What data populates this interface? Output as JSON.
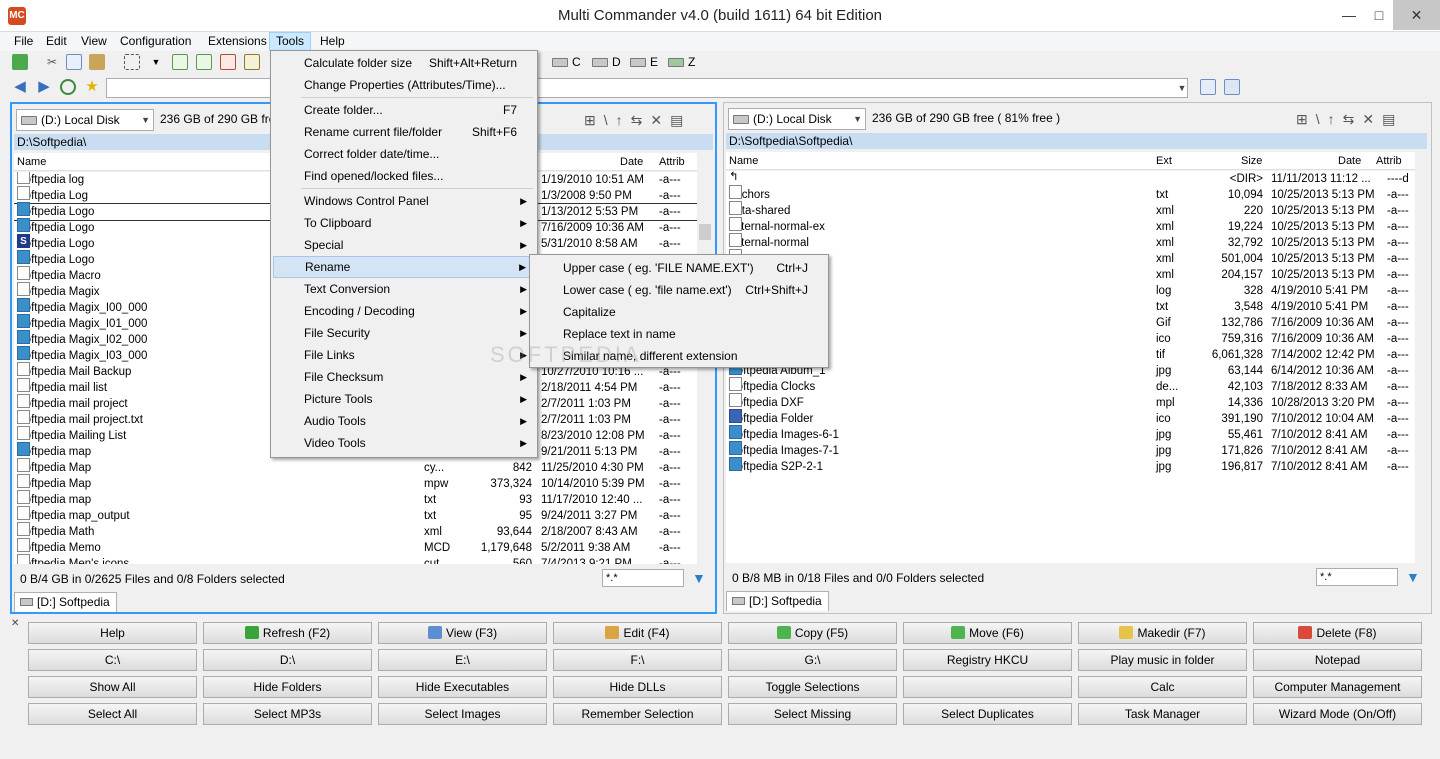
{
  "window": {
    "title": "Multi Commander v4.0 (build 1611) 64 bit Edition",
    "app_icon_text": "MC",
    "min_glyph": "—",
    "max_glyph": "□",
    "close_glyph": "✕"
  },
  "menubar": [
    "File",
    "Edit",
    "View",
    "Configuration",
    "Extensions",
    "Tools",
    "Help"
  ],
  "drives_toolbar": [
    {
      "letter": "C",
      "icon": "hard-drive-icon"
    },
    {
      "letter": "D",
      "icon": "hard-drive-icon"
    },
    {
      "letter": "E",
      "icon": "hard-drive-icon"
    },
    {
      "letter": "Z",
      "icon": "network-drive-icon"
    }
  ],
  "tools_menu": {
    "items": [
      {
        "label": "Calculate folder size",
        "shortcut": "Shift+Alt+Return",
        "submenu": false
      },
      {
        "label": "Change Properties (Attributes/Time)...",
        "shortcut": "",
        "submenu": false
      },
      {
        "label": "Create folder...",
        "shortcut": "F7",
        "submenu": false
      },
      {
        "label": "Rename current file/folder",
        "shortcut": "Shift+F6",
        "submenu": false
      },
      {
        "label": "Correct folder date/time...",
        "shortcut": "",
        "submenu": false
      },
      {
        "label": "Find opened/locked files...",
        "shortcut": "",
        "submenu": false
      },
      {
        "label": "Windows Control Panel",
        "shortcut": "",
        "submenu": true
      },
      {
        "label": "To Clipboard",
        "shortcut": "",
        "submenu": true
      },
      {
        "label": "Special",
        "shortcut": "",
        "submenu": true
      },
      {
        "label": "Rename",
        "shortcut": "",
        "submenu": true,
        "highlighted": true
      },
      {
        "label": "Text Conversion",
        "shortcut": "",
        "submenu": true
      },
      {
        "label": "Encoding / Decoding",
        "shortcut": "",
        "submenu": true
      },
      {
        "label": "File Security",
        "shortcut": "",
        "submenu": true
      },
      {
        "label": "File Links",
        "shortcut": "",
        "submenu": true
      },
      {
        "label": "File Checksum",
        "shortcut": "",
        "submenu": true
      },
      {
        "label": "Picture Tools",
        "shortcut": "",
        "submenu": true
      },
      {
        "label": "Audio Tools",
        "shortcut": "",
        "submenu": true
      },
      {
        "label": "Video Tools",
        "shortcut": "",
        "submenu": true
      }
    ],
    "submenu_arrow": "▶"
  },
  "rename_menu": [
    {
      "label": "Upper case ( eg. 'FILE NAME.EXT')",
      "shortcut": "Ctrl+J"
    },
    {
      "label": "Lower case ( eg. 'file name.ext')",
      "shortcut": "Ctrl+Shift+J"
    },
    {
      "label": "Capitalize",
      "shortcut": ""
    },
    {
      "label": "Replace text in name",
      "shortcut": ""
    },
    {
      "label": "Similar name, different extension",
      "shortcut": ""
    }
  ],
  "left_panel": {
    "drive": "(D:) Local Disk",
    "free": "236 GB of 290 GB free",
    "path": "D:\\Softpedia\\",
    "columns": {
      "name": "Name",
      "date": "Date",
      "attrib": "Attrib"
    },
    "rows": [
      {
        "name": "Softpedia log",
        "ext": "",
        "size": "",
        "date": "1/19/2010 10:51 AM",
        "attr": "-a---",
        "icon": "doc"
      },
      {
        "name": "Softpedia Log",
        "ext": "",
        "size": "",
        "date": "1/3/2008 9:50 PM",
        "attr": "-a---",
        "icon": "doc"
      },
      {
        "name": "Softpedia Logo",
        "ext": "",
        "size": "",
        "date": "1/13/2012 5:53 PM",
        "attr": "-a---",
        "icon": "img"
      },
      {
        "name": "Softpedia Logo",
        "ext": "",
        "size": "",
        "date": "7/16/2009 10:36 AM",
        "attr": "-a---",
        "icon": "img"
      },
      {
        "name": "Softpedia Logo",
        "ext": "",
        "size": "",
        "date": "5/31/2010 8:58 AM",
        "attr": "-a---",
        "icon": "s"
      },
      {
        "name": "Softpedia Logo",
        "ext": "",
        "size": "",
        "date": "",
        "attr": "",
        "icon": "img"
      },
      {
        "name": "Softpedia Macro",
        "ext": "",
        "size": "",
        "date": "",
        "attr": "",
        "icon": "doc"
      },
      {
        "name": "Softpedia Magix",
        "ext": "",
        "size": "",
        "date": "",
        "attr": "",
        "icon": "doc"
      },
      {
        "name": "Softpedia Magix_I00_000",
        "ext": "",
        "size": "",
        "date": "",
        "attr": "",
        "icon": "img"
      },
      {
        "name": "Softpedia Magix_I01_000",
        "ext": "",
        "size": "",
        "date": "",
        "attr": "",
        "icon": "img"
      },
      {
        "name": "Softpedia Magix_I02_000",
        "ext": "",
        "size": "",
        "date": "",
        "attr": "",
        "icon": "img"
      },
      {
        "name": "Softpedia Magix_I03_000",
        "ext": "",
        "size": "",
        "date": "",
        "attr": "",
        "icon": "img"
      },
      {
        "name": "Softpedia Mail Backup",
        "ext": "",
        "size": "",
        "date": "10/27/2010 10:16 ...",
        "attr": "-a---",
        "icon": "doc"
      },
      {
        "name": "Softpedia mail list",
        "ext": "",
        "size": "",
        "date": "2/18/2011 4:54 PM",
        "attr": "-a---",
        "icon": "doc"
      },
      {
        "name": "Softpedia mail project",
        "ext": "",
        "size": "",
        "date": "2/7/2011 1:03 PM",
        "attr": "-a---",
        "icon": "doc"
      },
      {
        "name": "Softpedia mail project.txt",
        "ext": "",
        "size": "",
        "date": "2/7/2011 1:03 PM",
        "attr": "-a---",
        "icon": "doc"
      },
      {
        "name": "Softpedia Mailing List",
        "ext": "",
        "size": "",
        "date": "8/23/2010 12:08 PM",
        "attr": "-a---",
        "icon": "doc"
      },
      {
        "name": "Softpedia map",
        "ext": "",
        "size": "",
        "date": "9/21/2011 5:13 PM",
        "attr": "-a---",
        "icon": "img"
      },
      {
        "name": "Softpedia Map",
        "ext": "cy...",
        "size": "842",
        "date": "11/25/2010 4:30 PM",
        "attr": "-a---",
        "icon": "doc"
      },
      {
        "name": "Softpedia Map",
        "ext": "mpw",
        "size": "373,324",
        "date": "10/14/2010 5:39 PM",
        "attr": "-a---",
        "icon": "doc"
      },
      {
        "name": "Softpedia map",
        "ext": "txt",
        "size": "93",
        "date": "11/17/2010 12:40 ...",
        "attr": "-a---",
        "icon": "doc"
      },
      {
        "name": "Softpedia map_output",
        "ext": "txt",
        "size": "95",
        "date": "9/24/2011 3:27 PM",
        "attr": "-a---",
        "icon": "doc"
      },
      {
        "name": "Softpedia Math",
        "ext": "xml",
        "size": "93,644",
        "date": "2/18/2007 8:43 AM",
        "attr": "-a---",
        "icon": "doc"
      },
      {
        "name": "Softpedia Memo",
        "ext": "MCD",
        "size": "1,179,648",
        "date": "5/2/2011 9:38 AM",
        "attr": "-a---",
        "icon": "doc"
      },
      {
        "name": "Softpedia Men's icons",
        "ext": "cut",
        "size": "560",
        "date": "7/4/2013 9:21 PM",
        "attr": "-a---",
        "icon": "doc"
      }
    ],
    "status": "0 B/4 GB in 0/2625 Files and 0/8 Folders selected",
    "filter": "*.*",
    "tab": "[D:] Softpedia"
  },
  "right_panel": {
    "drive": "(D:) Local Disk",
    "free": "236 GB of 290 GB free ( 81% free )",
    "path": "D:\\Softpedia\\Softpedia\\",
    "columns": {
      "name": "Name",
      "ext": "Ext",
      "size": "Size",
      "date": "Date",
      "attrib": "Attrib"
    },
    "rows": [
      {
        "name": "..",
        "ext": "",
        "size": "<DIR>",
        "date": "11/11/2013 11:12 ...",
        "attr": "----d",
        "icon": "up"
      },
      {
        "name": "anchors",
        "ext": "txt",
        "size": "10,094",
        "date": "10/25/2013 5:13 PM",
        "attr": "-a---",
        "icon": "doc"
      },
      {
        "name": "data-shared",
        "ext": "xml",
        "size": "220",
        "date": "10/25/2013 5:13 PM",
        "attr": "-a---",
        "icon": "doc"
      },
      {
        "name": "external-normal-ex",
        "ext": "xml",
        "size": "19,224",
        "date": "10/25/2013 5:13 PM",
        "attr": "-a---",
        "icon": "doc"
      },
      {
        "name": "external-normal",
        "ext": "xml",
        "size": "32,792",
        "date": "10/25/2013 5:13 PM",
        "attr": "-a---",
        "icon": "doc"
      },
      {
        "name": "",
        "ext": "xml",
        "size": "501,004",
        "date": "10/25/2013 5:13 PM",
        "attr": "-a---",
        "icon": "doc"
      },
      {
        "name": "",
        "ext": "xml",
        "size": "204,157",
        "date": "10/25/2013 5:13 PM",
        "attr": "-a---",
        "icon": "doc"
      },
      {
        "name": "",
        "ext": "log",
        "size": "328",
        "date": "4/19/2010 5:41 PM",
        "attr": "-a---",
        "icon": "doc"
      },
      {
        "name": "",
        "ext": "txt",
        "size": "3,548",
        "date": "4/19/2010 5:41 PM",
        "attr": "-a---",
        "icon": "doc"
      },
      {
        "name": "",
        "ext": "Gif",
        "size": "132,786",
        "date": "7/16/2009 10:36 AM",
        "attr": "-a---",
        "icon": "img"
      },
      {
        "name": "",
        "ext": "ico",
        "size": "759,316",
        "date": "7/16/2009 10:36 AM",
        "attr": "-a---",
        "icon": "img"
      },
      {
        "name": "",
        "ext": "tif",
        "size": "6,061,328",
        "date": "7/14/2002 12:42 PM",
        "attr": "-a---",
        "icon": "img"
      },
      {
        "name": "Softpedia Album_1",
        "ext": "jpg",
        "size": "63,144",
        "date": "6/14/2012 10:36 AM",
        "attr": "-a---",
        "icon": "img"
      },
      {
        "name": "Softpedia Clocks",
        "ext": "de...",
        "size": "42,103",
        "date": "7/18/2012 8:33 AM",
        "attr": "-a---",
        "icon": "doc"
      },
      {
        "name": "Softpedia DXF",
        "ext": "mpl",
        "size": "14,336",
        "date": "10/28/2013 3:20 PM",
        "attr": "-a---",
        "icon": "doc"
      },
      {
        "name": "Softpedia Folder",
        "ext": "ico",
        "size": "391,190",
        "date": "7/10/2012 10:04 AM",
        "attr": "-a---",
        "icon": "folder"
      },
      {
        "name": "Softpedia Images-6-1",
        "ext": "jpg",
        "size": "55,461",
        "date": "7/10/2012 8:41 AM",
        "attr": "-a---",
        "icon": "img"
      },
      {
        "name": "Softpedia Images-7-1",
        "ext": "jpg",
        "size": "171,826",
        "date": "7/10/2012 8:41 AM",
        "attr": "-a---",
        "icon": "img"
      },
      {
        "name": "Softpedia S2P-2-1",
        "ext": "jpg",
        "size": "196,817",
        "date": "7/10/2012 8:41 AM",
        "attr": "-a---",
        "icon": "img"
      }
    ],
    "status": "0 B/8 MB in 0/18 Files and 0/0 Folders selected",
    "filter": "*.*",
    "tab": "[D:] Softpedia"
  },
  "button_rows": [
    [
      {
        "label": "Help",
        "icon": ""
      },
      {
        "label": "Refresh (F2)",
        "icon": "refresh-icon",
        "color": "#3aa33a"
      },
      {
        "label": "View (F3)",
        "icon": "view-icon",
        "color": "#5b8fd1"
      },
      {
        "label": "Edit (F4)",
        "icon": "edit-icon",
        "color": "#d9a441"
      },
      {
        "label": "Copy (F5)",
        "icon": "copy-icon",
        "color": "#4fb34f"
      },
      {
        "label": "Move (F6)",
        "icon": "move-icon",
        "color": "#4fb34f"
      },
      {
        "label": "Makedir (F7)",
        "icon": "makedir-icon",
        "color": "#e8c34a"
      },
      {
        "label": "Delete (F8)",
        "icon": "delete-icon",
        "color": "#d94a3a"
      }
    ],
    [
      {
        "label": "C:\\"
      },
      {
        "label": "D:\\"
      },
      {
        "label": "E:\\"
      },
      {
        "label": "F:\\"
      },
      {
        "label": "G:\\"
      },
      {
        "label": "Registry HKCU"
      },
      {
        "label": "Play music in folder"
      },
      {
        "label": "Notepad"
      }
    ],
    [
      {
        "label": "Show All"
      },
      {
        "label": "Hide Folders"
      },
      {
        "label": "Hide Executables"
      },
      {
        "label": "Hide DLLs"
      },
      {
        "label": "Toggle Selections"
      },
      {
        "label": ""
      },
      {
        "label": "Calc"
      },
      {
        "label": "Computer Management"
      }
    ],
    [
      {
        "label": "Select All"
      },
      {
        "label": "Select MP3s"
      },
      {
        "label": "Select Images"
      },
      {
        "label": "Remember Selection"
      },
      {
        "label": "Select Missing"
      },
      {
        "label": "Select Duplicates"
      },
      {
        "label": "Task Manager"
      },
      {
        "label": "Wizard Mode (On/Off)"
      }
    ]
  ],
  "buttonbar_close": "✕",
  "watermark": "SOFTPEDIA"
}
